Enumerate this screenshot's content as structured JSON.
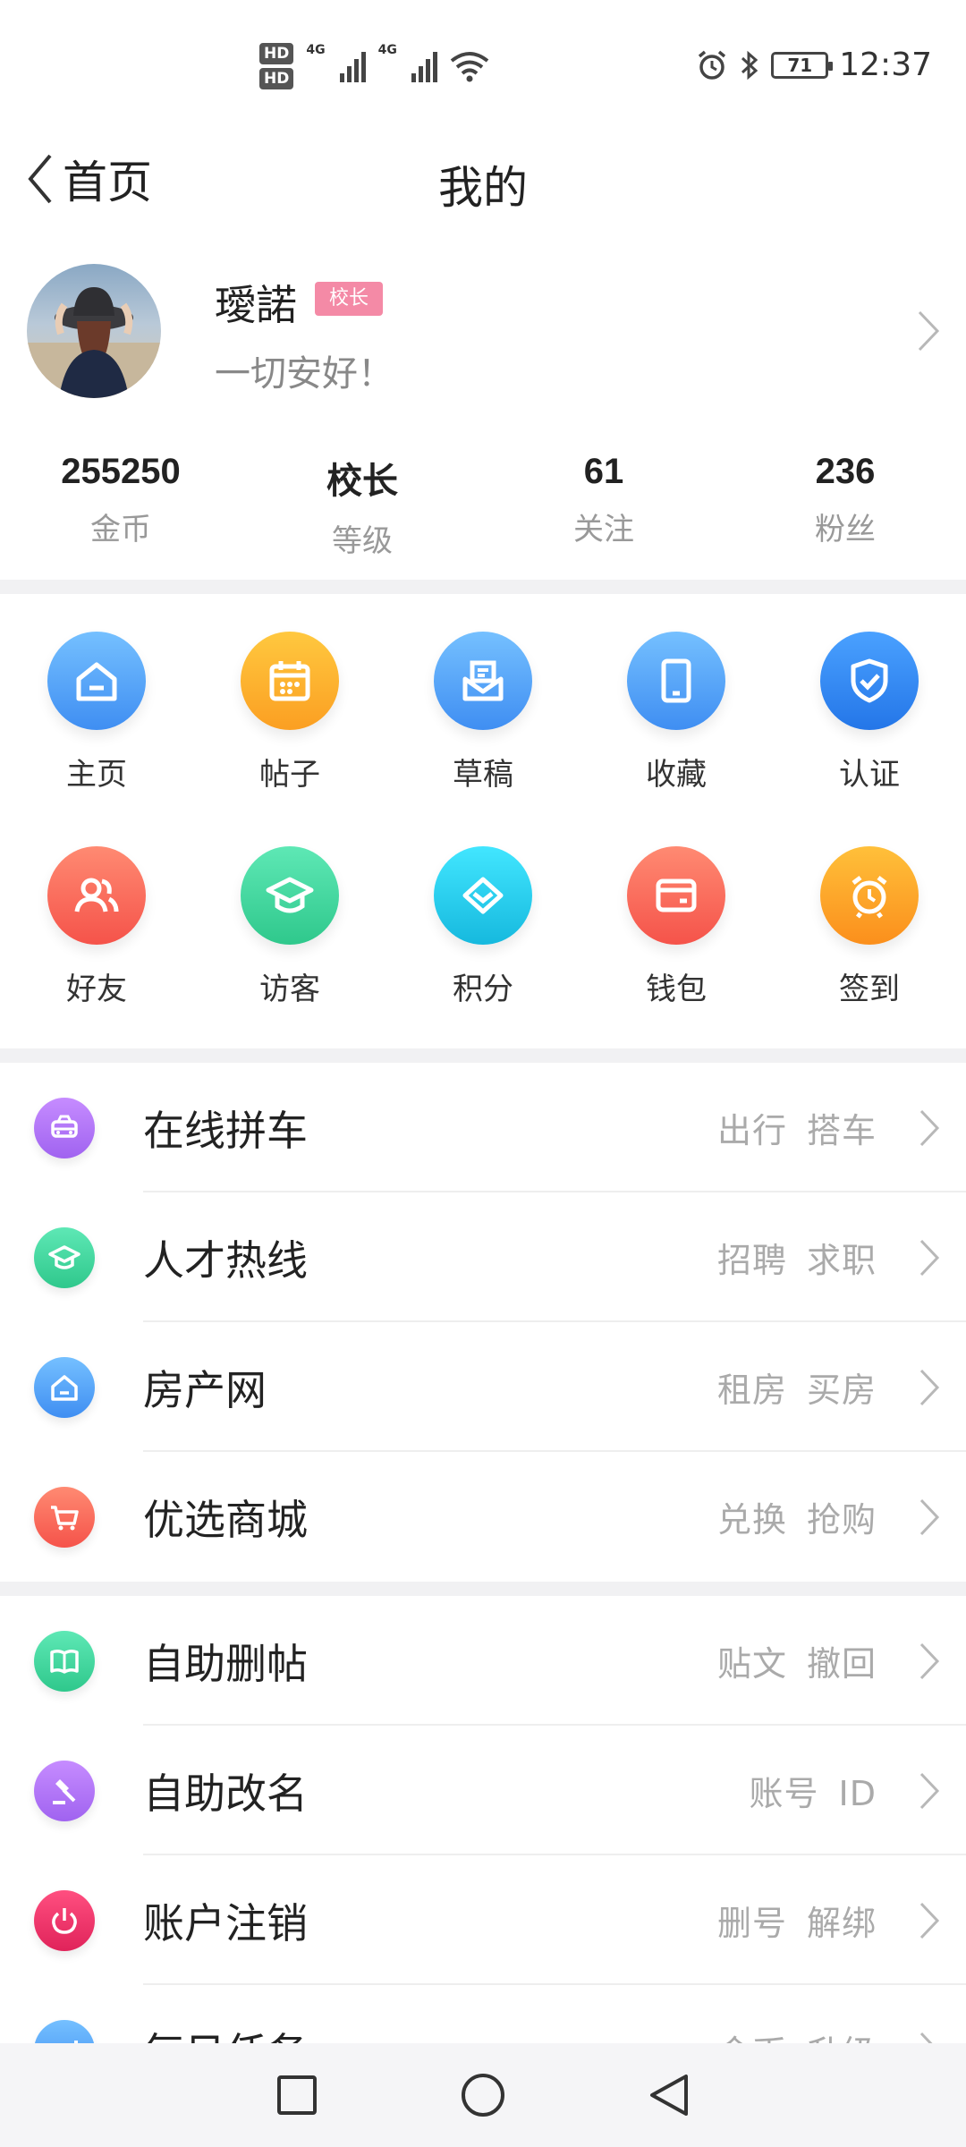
{
  "status_bar": {
    "hd1": "HD",
    "hd2": "HD",
    "network1": "4G",
    "network2": "4G",
    "battery": "71",
    "time": "12:37"
  },
  "header": {
    "back_label": "首页",
    "title": "我的"
  },
  "profile": {
    "username": "璦諾",
    "badge": "校长",
    "signature": "一切安好！"
  },
  "stats": [
    {
      "value": "255250",
      "label": "金币"
    },
    {
      "value": "校长",
      "label": "等级"
    },
    {
      "value": "61",
      "label": "关注"
    },
    {
      "value": "236",
      "label": "粉丝"
    }
  ],
  "grid": [
    {
      "label": "主页",
      "icon": "home-icon",
      "color": "#5aa9f8"
    },
    {
      "label": "帖子",
      "icon": "calendar-icon",
      "color": "#fbb63a"
    },
    {
      "label": "草稿",
      "icon": "draft-icon",
      "color": "#5aa9f8"
    },
    {
      "label": "收藏",
      "icon": "tablet-icon",
      "color": "#5aa9f8"
    },
    {
      "label": "认证",
      "icon": "shield-icon",
      "color": "#3a8ef0"
    },
    {
      "label": "好友",
      "icon": "friends-icon",
      "color": "#f86a55"
    },
    {
      "label": "访客",
      "icon": "graduation-cap-icon",
      "color": "#3dd6a0"
    },
    {
      "label": "积分",
      "icon": "diamond-icon",
      "color": "#2ad0e8"
    },
    {
      "label": "钱包",
      "icon": "wallet-icon",
      "color": "#f8685a"
    },
    {
      "label": "签到",
      "icon": "alarm-clock-icon",
      "color": "#fb9f22"
    }
  ],
  "list_group1": [
    {
      "label": "在线拼车",
      "tags": [
        "出行",
        "搭车"
      ],
      "icon": "car-icon",
      "color": "#b277f4"
    },
    {
      "label": "人才热线",
      "tags": [
        "招聘",
        "求职"
      ],
      "icon": "graduation-cap-icon",
      "color": "#3dd6a0"
    },
    {
      "label": "房产网",
      "tags": [
        "租房",
        "买房"
      ],
      "icon": "home-icon",
      "color": "#5aa9f8"
    },
    {
      "label": "优选商城",
      "tags": [
        "兑换",
        "抢购"
      ],
      "icon": "cart-icon",
      "color": "#f86a55"
    }
  ],
  "list_group2": [
    {
      "label": "自助删帖",
      "tags": [
        "贴文",
        "撤回"
      ],
      "icon": "book-icon",
      "color": "#3dd6a0"
    },
    {
      "label": "自助改名",
      "tags": [
        "账号",
        "ID"
      ],
      "icon": "gavel-icon",
      "color": "#b277f4"
    },
    {
      "label": "账户注销",
      "tags": [
        "删号",
        "解绑"
      ],
      "icon": "power-icon",
      "color": "#f03a6a"
    },
    {
      "label": "每日任务",
      "tags": [
        "金币",
        "升级"
      ],
      "icon": "chart-icon",
      "color": "#5aa9f8"
    }
  ]
}
